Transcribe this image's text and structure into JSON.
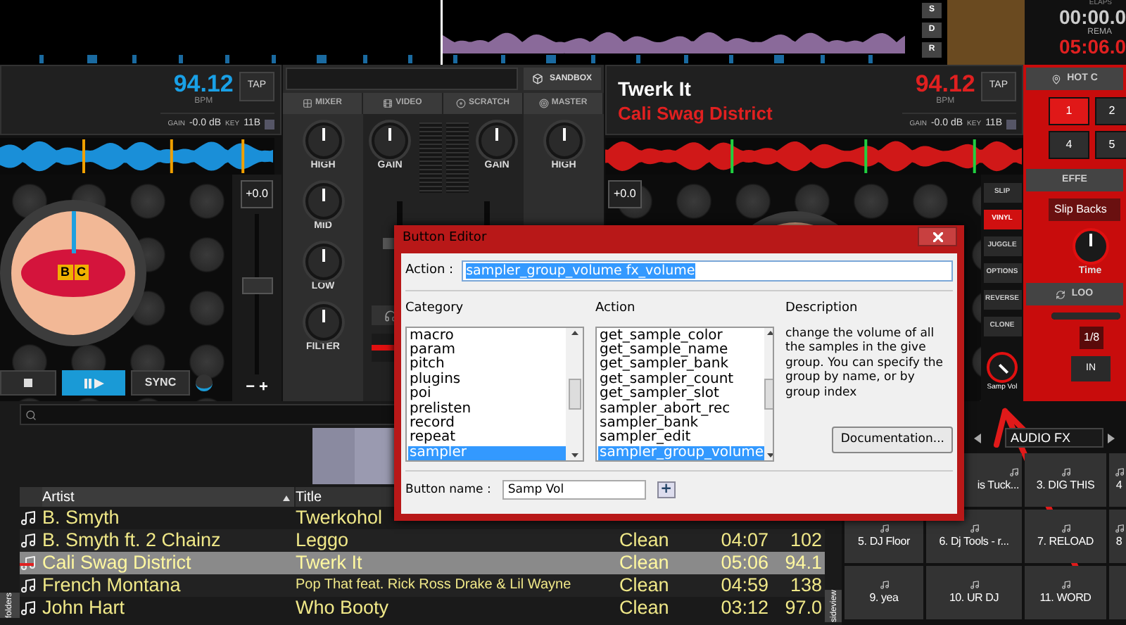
{
  "top_bar": {
    "deck_letters": [
      "S",
      "D",
      "R"
    ],
    "elapsed_label": "ELAPS",
    "elapsed": "00:00.0",
    "remain_label": "REMA",
    "remain": "05:06.0"
  },
  "left_deck": {
    "bpm": "94.12",
    "bpm_label": "BPM",
    "tap": "TAP",
    "gain_label": "GAIN",
    "gain": "-0.0 dB",
    "key_label": "KEY",
    "key": "11B",
    "pitch": "+0.0",
    "logo_letters": [
      "B",
      "C"
    ],
    "transport": [
      {
        "kind": "stop",
        "selected": false
      },
      {
        "kind": "play",
        "selected": true
      },
      {
        "kind": "text",
        "label": "SYNC",
        "selected": false
      }
    ],
    "pitch_buttons": [
      "−",
      "+"
    ],
    "pitch_slider": {
      "level": 0.55
    }
  },
  "mixer": {
    "sandbox": "SANDBOX",
    "tabs": [
      {
        "label": "MIXER",
        "selected": false
      },
      {
        "label": "VIDEO",
        "selected": false
      },
      {
        "label": "SCRATCH",
        "selected": false
      },
      {
        "label": "MASTER",
        "selected": false
      }
    ],
    "left_knobs": [
      "HIGH",
      "MID",
      "LOW",
      "FILTER"
    ],
    "gain_knobs": [
      "GAIN",
      "GAIN"
    ],
    "right_knobs": [
      "HIGH"
    ]
  },
  "right_deck": {
    "title": "Twerk It",
    "artist": "Cali Swag District",
    "bpm": "94.12",
    "bpm_label": "BPM",
    "tap": "TAP",
    "gain_label": "GAIN",
    "gain": "-0.0 dB",
    "key_label": "KEY",
    "key": "11B",
    "pitch": "+0.0",
    "side_buttons": [
      {
        "label": "SLIP",
        "selected": false
      },
      {
        "label": "VINYL",
        "selected": true
      },
      {
        "label": "JUGGLE",
        "selected": false
      },
      {
        "label": "OPTIONS",
        "selected": false
      },
      {
        "label": "REVERSE",
        "selected": false
      },
      {
        "label": "CLONE",
        "selected": false
      }
    ],
    "knob_label": "Samp Vol"
  },
  "side_panel": {
    "hot_cue_title": "HOT C",
    "hot_cues": [
      {
        "label": "1",
        "selected": true
      },
      {
        "label": "2",
        "selected": false
      },
      {
        "label": "4",
        "selected": false
      },
      {
        "label": "5",
        "selected": false
      }
    ],
    "effects_title": "EFFE",
    "effect": "Slip Backs",
    "effect_knob": "Time",
    "loop_title": "LOO",
    "loop_slider": {
      "level": 1
    },
    "loop_size": "1/8",
    "loop_in": "IN"
  },
  "browser": {
    "columns": [
      {
        "label": "Artist",
        "sorted": true
      },
      {
        "label": "Title"
      }
    ],
    "rows": [
      {
        "artist": "B. Smyth",
        "title": "Twerkohol",
        "selected": false
      },
      {
        "artist": "B. Smyth ft. 2 Chainz",
        "title": "Leggo",
        "column_3": "Clean",
        "column_4": "04:07",
        "column_5": "102",
        "selected": false
      },
      {
        "artist": "Cali Swag District",
        "title": "Twerk It",
        "column_3": "Clean",
        "column_4": "05:06",
        "column_5": "94.1",
        "selected": true
      },
      {
        "artist": "French Montana",
        "title": "Pop That feat. Rick Ross Drake & Lil Wayne",
        "column_3": "Clean",
        "column_4": "04:59",
        "column_5": "138",
        "selected": false
      },
      {
        "artist": "John Hart",
        "title": "Who Booty",
        "column_3": "Clean",
        "column_4": "03:12",
        "column_5": "97.0",
        "selected": false
      }
    ],
    "folders_tab": "folders",
    "sideview_tab": "sideview"
  },
  "sampler": {
    "bank": "AUDIO FX",
    "pads": [
      "is Tuck...",
      "3. DIG THIS",
      "4",
      "5. DJ Floor",
      "6. Dj Tools - r...",
      "7. RELOAD",
      "8",
      "9. yea",
      "10. UR DJ",
      "11. WORD"
    ]
  },
  "dialog": {
    "title": "Button Editor",
    "action_label": "Action :",
    "action_value": "sampler_group_volume fx_volume",
    "category_label": "Category",
    "action_list_label": "Action",
    "description_label": "Description",
    "categories": [
      {
        "label": "macro",
        "selected": false
      },
      {
        "label": "param",
        "selected": false
      },
      {
        "label": "pitch",
        "selected": false
      },
      {
        "label": "plugins",
        "selected": false
      },
      {
        "label": "poi",
        "selected": false
      },
      {
        "label": "prelisten",
        "selected": false
      },
      {
        "label": "record",
        "selected": false
      },
      {
        "label": "repeat",
        "selected": false
      },
      {
        "label": "sampler",
        "selected": true
      }
    ],
    "actions": [
      {
        "label": "get_sample_color",
        "selected": false
      },
      {
        "label": "get_sample_name",
        "selected": false
      },
      {
        "label": "get_sampler_bank",
        "selected": false
      },
      {
        "label": "get_sampler_count",
        "selected": false
      },
      {
        "label": "get_sampler_slot",
        "selected": false
      },
      {
        "label": "sampler_abort_rec",
        "selected": false
      },
      {
        "label": "sampler_bank",
        "selected": false
      },
      {
        "label": "sampler_edit",
        "selected": false
      },
      {
        "label": "sampler_group_volume",
        "selected": true
      }
    ],
    "description": "change the volume of all the samples in the give group. You can specify the group by name, or by group index",
    "documentation_button": "Documentation...",
    "button_name_label": "Button name :",
    "button_name_value": "Samp Vol",
    "add_button": "+"
  }
}
